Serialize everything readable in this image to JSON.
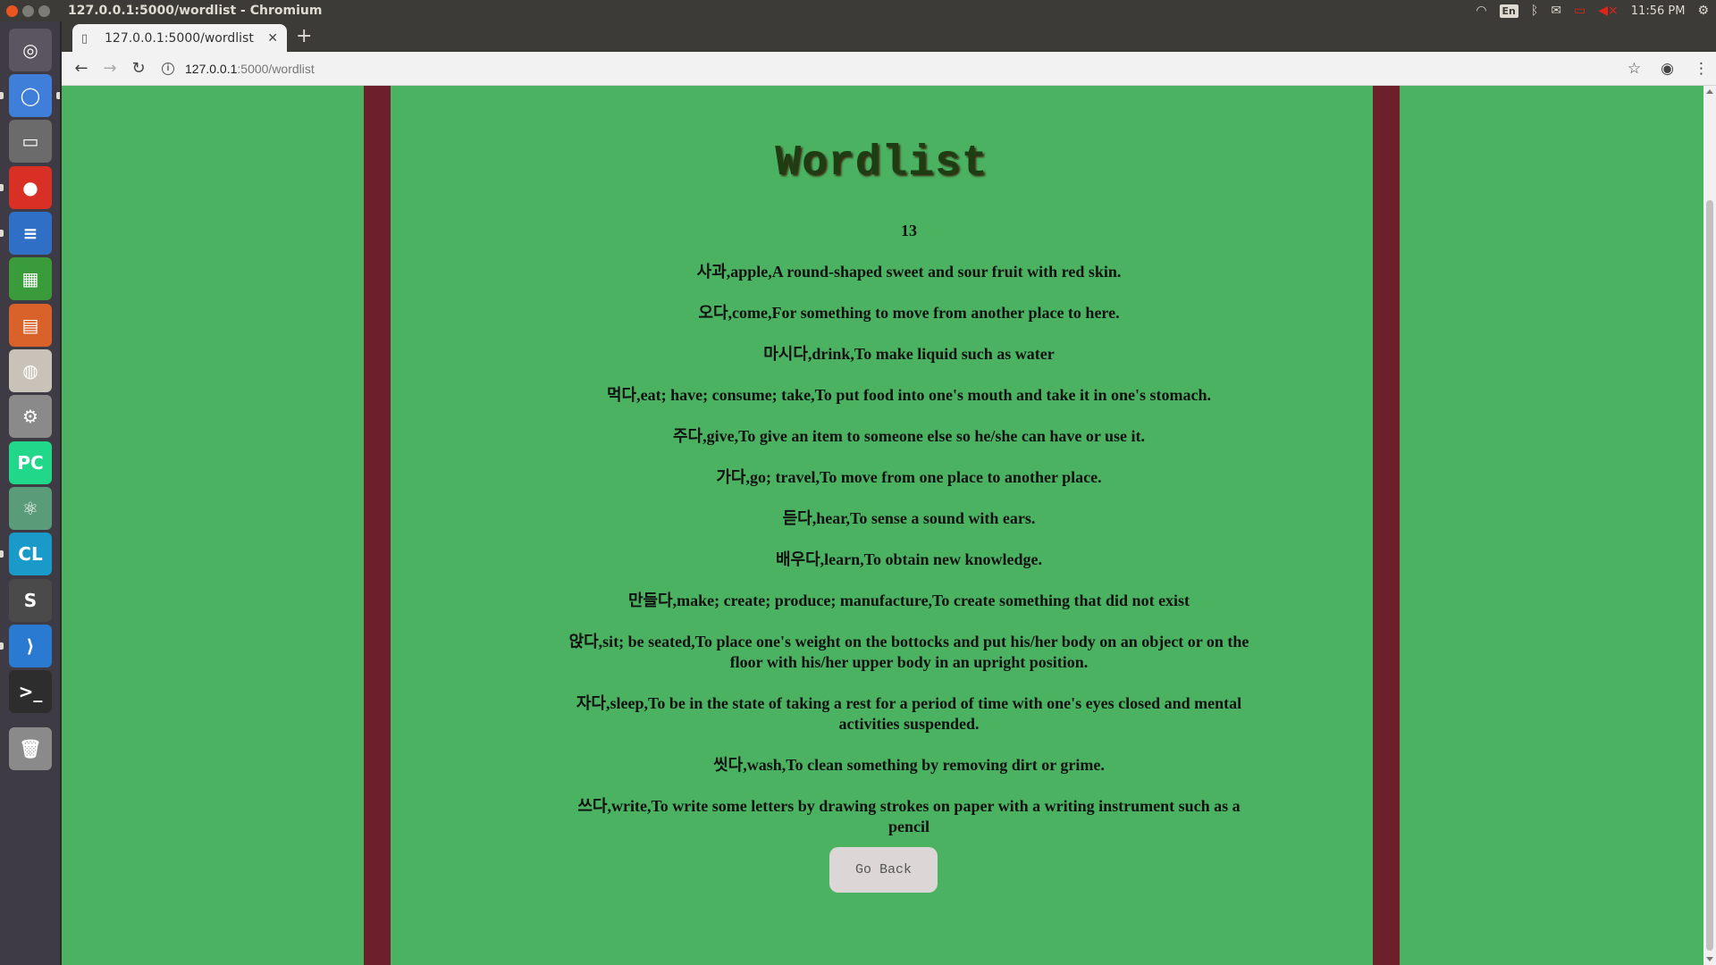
{
  "system": {
    "window_title": "127.0.0.1:5000/wordlist - Chromium",
    "keyboard_layout": "En",
    "clock": "11:56 PM"
  },
  "launcher": {
    "items": [
      {
        "name": "ubuntu-dash-icon",
        "glyph": "◎",
        "bg": "#5a5560"
      },
      {
        "name": "chromium-launcher-icon",
        "glyph": "◯",
        "bg": "#3f7fd9"
      },
      {
        "name": "files-launcher-icon",
        "glyph": "▭",
        "bg": "#6b6b6b"
      },
      {
        "name": "chrome-launcher-icon",
        "glyph": "●",
        "bg": "#d93025"
      },
      {
        "name": "writer-launcher-icon",
        "glyph": "≡",
        "bg": "#2f6fc6"
      },
      {
        "name": "calc-launcher-icon",
        "glyph": "▦",
        "bg": "#3a9b3a"
      },
      {
        "name": "impress-launcher-icon",
        "glyph": "▤",
        "bg": "#d9622b"
      },
      {
        "name": "software-center-icon",
        "glyph": "◍",
        "bg": "#c9c2b8"
      },
      {
        "name": "settings-launcher-icon",
        "glyph": "⚙",
        "bg": "#8a8a8a"
      },
      {
        "name": "pycharm-launcher-icon",
        "glyph": "PC",
        "bg": "#21d789"
      },
      {
        "name": "atom-launcher-icon",
        "glyph": "⚛",
        "bg": "#5a9b7a"
      },
      {
        "name": "clion-launcher-icon",
        "glyph": "CL",
        "bg": "#1a9ac9"
      },
      {
        "name": "sublime-launcher-icon",
        "glyph": "S",
        "bg": "#4a4a4a"
      },
      {
        "name": "vscode-launcher-icon",
        "glyph": "⟩",
        "bg": "#2a7ad1"
      },
      {
        "name": "terminal-launcher-icon",
        "glyph": ">_",
        "bg": "#2d2d2d"
      },
      {
        "name": "trash-launcher-icon",
        "glyph": "🗑",
        "bg": "#8a8a8a"
      }
    ]
  },
  "browser": {
    "tab_title": "127.0.0.1:5000/wordlist",
    "url_host": "127.0.0.1",
    "url_path": ":5000/wordlist"
  },
  "page": {
    "title": "Wordlist",
    "count": "13",
    "entries": [
      "사과,apple,A round-shaped sweet and sour fruit with red skin.",
      "오다,come,For something to move from another place to here.",
      "마시다,drink,To make liquid such as water",
      "먹다,eat; have; consume; take,To put food into one's mouth and take it in one's stomach.",
      "주다,give,To give an item to someone else so he/she can have or use it.",
      "가다,go; travel,To move from one place to another place.",
      "듣다,hear,To sense a sound with ears.",
      "배우다,learn,To obtain new knowledge.",
      "만들다,make; create; produce; manufacture,To create something that did not exist",
      "앉다,sit; be seated,To place one's weight on the bottocks and put his/her body on an object or on the floor with his/her upper body in an upright position.",
      "자다,sleep,To be in the state of taking a rest for a period of time with one's eyes closed and mental activities suspended.",
      "씻다,wash,To clean something by removing dirt or grime.",
      "쓰다,write,To write some letters by drawing strokes on paper with a writing instrument such as a pencil"
    ],
    "back_button": "Go Back",
    "colors": {
      "background": "#4bb262",
      "stripe": "#6d1f2b",
      "button": "#ddd6d6"
    }
  }
}
